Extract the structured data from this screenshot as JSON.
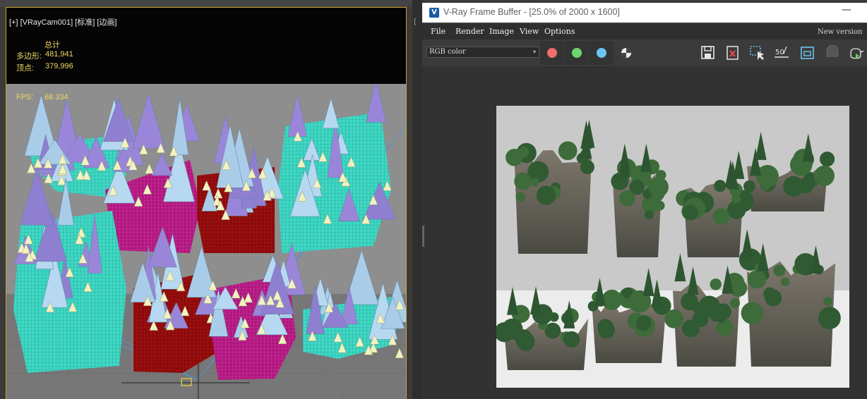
{
  "viewport": {
    "label": "[+] [VRayCam001] [标准] [边画]",
    "stats_header": "总计",
    "polys_label": "多边形:",
    "polys_value": "481,941",
    "verts_label": "顶点:",
    "verts_value": "379,996",
    "fps_label": "FPS:",
    "fps_value": "68.334",
    "colors": {
      "frame_border": "#c9a227",
      "stats_text": "#f0d860",
      "cyan_mesh": "#3fd8c4",
      "magenta_mesh": "#b0177f",
      "red_mesh": "#8a0a0a",
      "cone_light": "#a9cde8",
      "cone_purple": "#9a86d8"
    }
  },
  "side_glyph": "[",
  "vfb": {
    "title": "V-Ray Frame Buffer - [25.0% of 2000 x 1600]",
    "logo_letter": "V",
    "minimize_glyph": "—",
    "menu": [
      "File",
      "Render",
      "Image",
      "View",
      "Options"
    ],
    "new_version": "New version",
    "channel": "RGB color",
    "channel_caret": "▾",
    "channel_colors": {
      "red": "#f06d6d",
      "green": "#6ed46e",
      "blue": "#6cc4f0"
    },
    "toolbar_icons": [
      "save-icon",
      "clear-icon",
      "region-select-icon",
      "compare-50-icon",
      "region-render-icon",
      "track-mouse-icon",
      "teapot-render-icon"
    ],
    "compare_label": "50",
    "colors": {
      "titlebar": "#ffffff",
      "menubar": "#2f2f2f",
      "toolbar": "#3b3b3b",
      "canvas": "#323232",
      "render_bg": "#c8c8c8"
    }
  }
}
